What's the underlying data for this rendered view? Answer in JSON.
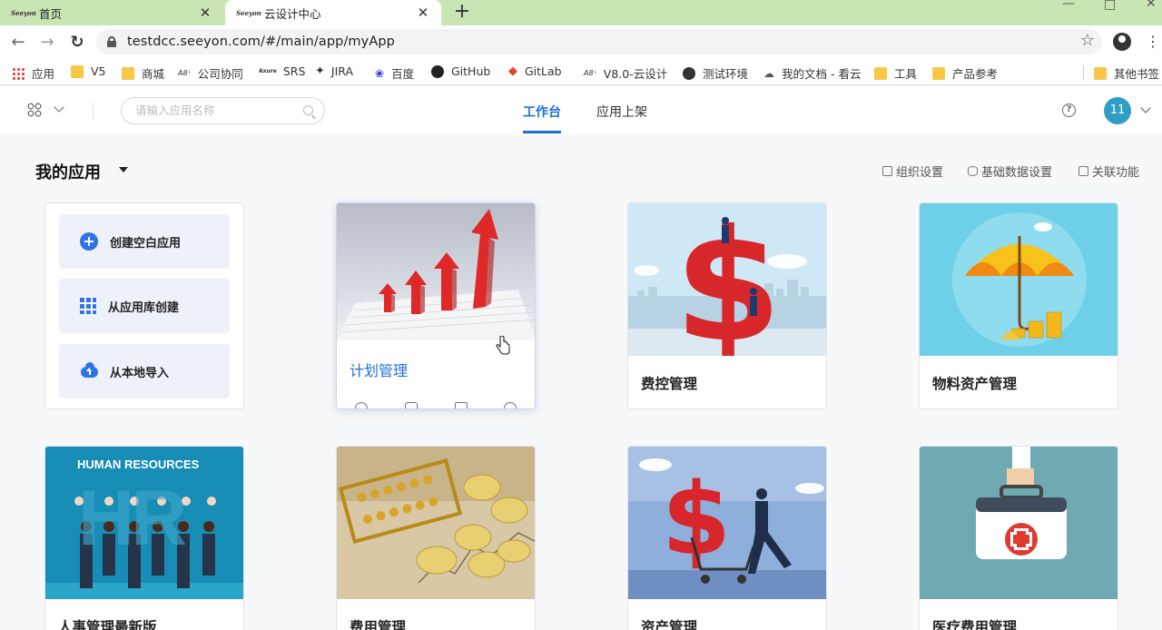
{
  "browser": {
    "tabs": [
      {
        "title": "首页",
        "favicon": "seeyon-logo-icon",
        "active": false
      },
      {
        "title": "云设计中心",
        "favicon": "seeyon-logo-icon",
        "active": true
      }
    ],
    "favicon_text": "Seeyon",
    "url": "testdcc.seeyon.com/#/main/app/myApp",
    "bookmarks": [
      {
        "label": "应用",
        "icon": "apps-grid-icon"
      },
      {
        "label": "V5",
        "icon": "folder-icon"
      },
      {
        "label": "商城",
        "icon": "folder-icon"
      },
      {
        "label": "公司协同",
        "icon": "a8-icon",
        "prefix": "A8⁺"
      },
      {
        "label": "SRS",
        "icon": "axure-icon",
        "prefix": "Axure"
      },
      {
        "label": "JIRA",
        "icon": "jira-icon"
      },
      {
        "label": "百度",
        "icon": "baidu-paw-icon"
      },
      {
        "label": "GitHub",
        "icon": "github-icon"
      },
      {
        "label": "GitLab",
        "icon": "gitlab-icon"
      },
      {
        "label": "V8.0-云设计",
        "icon": "a8-icon",
        "prefix": "A8⁺"
      },
      {
        "label": "测试环境",
        "icon": "globe-icon"
      },
      {
        "label": "我的文档 - 看云",
        "icon": "cloud-doc-icon"
      },
      {
        "label": "工具",
        "icon": "folder-icon"
      },
      {
        "label": "产品参考",
        "icon": "folder-icon"
      }
    ],
    "other_bookmarks": "其他书签"
  },
  "header": {
    "search_placeholder": "请输入应用名称",
    "nav_tabs": [
      {
        "label": "工作台",
        "active": true
      },
      {
        "label": "应用上架",
        "active": false
      }
    ],
    "avatar_text": "11",
    "accent_color": "#1f6fd6",
    "avatar_color": "#2f9ec4"
  },
  "section": {
    "title": "我的应用",
    "tools": [
      "组织设置",
      "基础数据设置",
      "关联功能"
    ]
  },
  "create_panel": {
    "buttons": [
      "创建空白应用",
      "从应用库创建",
      "从本地导入"
    ]
  },
  "apps": [
    {
      "name": "计划管理",
      "thumb": "red-arrows-chart-image",
      "hover": true
    },
    {
      "name": "费控管理",
      "thumb": "dollar-sign-climbers-image",
      "hover": false
    },
    {
      "name": "物料资产管理",
      "thumb": "umbrella-coins-image",
      "hover": false
    },
    {
      "name": "人事管理最新版",
      "thumb": "human-resources-image",
      "hover": false,
      "thumb_text": "HUMAN RESOURCES",
      "thumb_bg_text": "HR"
    },
    {
      "name": "费用管理",
      "thumb": "abacus-coins-image",
      "hover": false
    },
    {
      "name": "资产管理",
      "thumb": "dollar-cart-runner-image",
      "hover": false
    },
    {
      "name": "医疗费用管理",
      "thumb": "medical-case-image",
      "hover": false
    }
  ]
}
